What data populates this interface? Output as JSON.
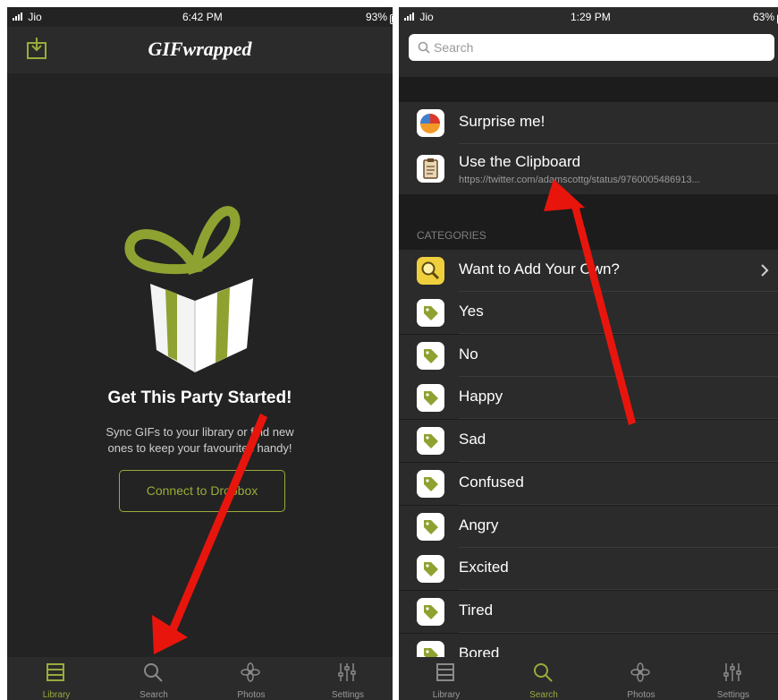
{
  "left": {
    "status": {
      "carrier": "Jio",
      "time": "6:42 PM",
      "battery": "93%",
      "battery_level": 0.93
    },
    "app_title": "GIFwrapped",
    "heading": "Get This Party Started!",
    "subtitle_line1": "Sync GIFs to your library or find new",
    "subtitle_line2": "ones to keep your favourites handy!",
    "connect_button": "Connect to Dropbox",
    "tabs": [
      {
        "label": "Library",
        "icon": "library-icon",
        "active": true
      },
      {
        "label": "Search",
        "icon": "search-icon",
        "active": false
      },
      {
        "label": "Photos",
        "icon": "photos-icon",
        "active": false
      },
      {
        "label": "Settings",
        "icon": "settings-icon",
        "active": false
      }
    ]
  },
  "right": {
    "status": {
      "carrier": "Jio",
      "time": "1:29 PM",
      "battery": "63%",
      "battery_level": 0.63
    },
    "search_placeholder": "Search",
    "quick": [
      {
        "label": "Surprise me!",
        "icon": "surprise-icon"
      },
      {
        "label": "Use the Clipboard",
        "sublabel": "https://twitter.com/adamscottg/status/9760005486913...",
        "icon": "clipboard-icon"
      }
    ],
    "categories_header": "CATEGORIES",
    "add_own": "Want to Add Your Own?",
    "categories": [
      "Yes",
      "No",
      "Happy",
      "Sad",
      "Confused",
      "Angry",
      "Excited",
      "Tired",
      "Bored"
    ],
    "tabs": [
      {
        "label": "Library",
        "icon": "library-icon",
        "active": false
      },
      {
        "label": "Search",
        "icon": "search-icon",
        "active": true
      },
      {
        "label": "Photos",
        "icon": "photos-icon",
        "active": false
      },
      {
        "label": "Settings",
        "icon": "settings-icon",
        "active": false
      }
    ]
  },
  "colors": {
    "accent": "#9aab3a",
    "arrow": "#e8150d",
    "background": "#232323"
  }
}
